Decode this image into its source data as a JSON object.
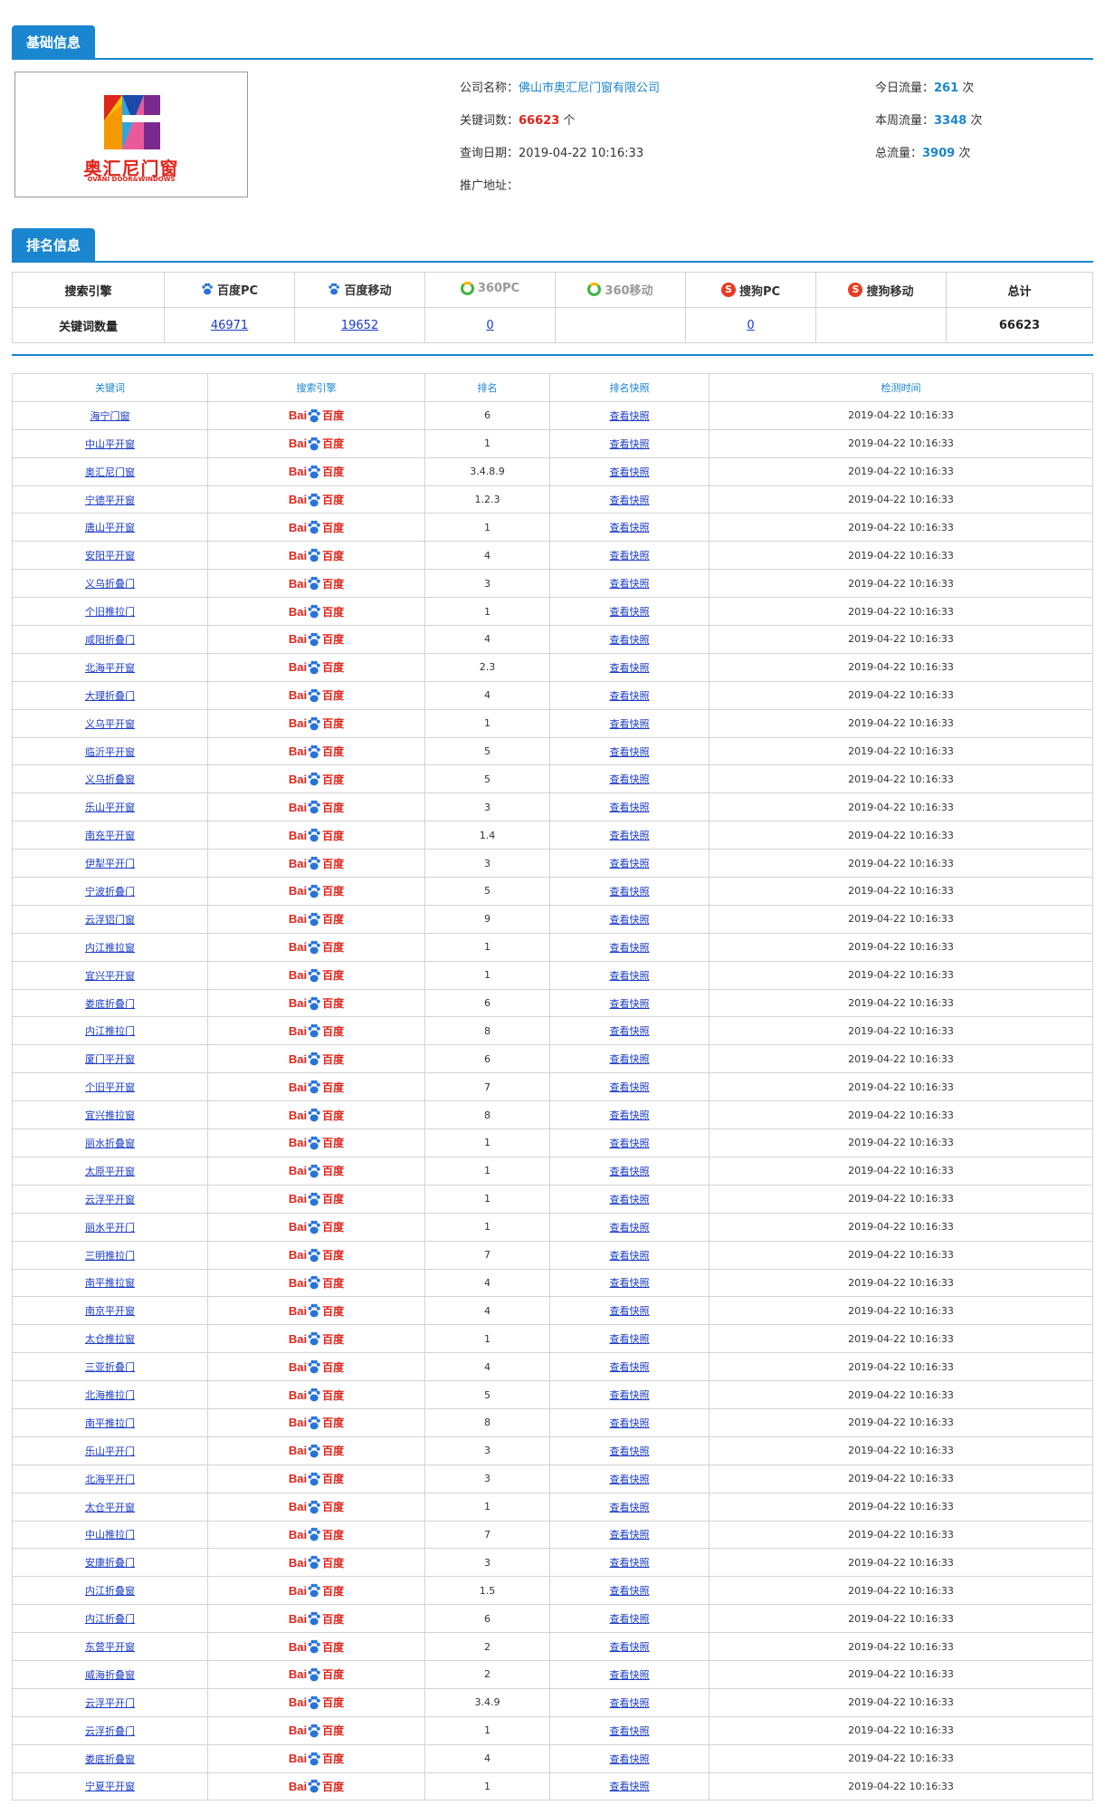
{
  "basic": {
    "tab": "基础信息",
    "logo_cn": "奥汇尼门窗",
    "logo_en": "OVANI DOOR&WINDOWS",
    "company_label": "公司名称：",
    "company_value": "佛山市奥汇尼门窗有限公司",
    "keywords_label": "关键词数：",
    "keywords_value": "66623",
    "keywords_unit": "个",
    "date_label": "查询日期：",
    "date_value": "2019-04-22 10:16:33",
    "promo_label": "推广地址：",
    "today_label": "今日流量：",
    "today_value": "261",
    "week_label": "本周流量：",
    "week_value": "3348",
    "total_label": "总流量：",
    "total_value": "3909",
    "times_unit": "次"
  },
  "ranking": {
    "tab": "排名信息",
    "header_first": "搜索引擎",
    "engines": [
      "百度PC",
      "百度移动",
      "360PC",
      "360移动",
      "搜狗PC",
      "搜狗移动"
    ],
    "header_total": "总计",
    "row_label": "关键词数量",
    "counts": [
      "46971",
      "19652",
      "0",
      "",
      "0",
      ""
    ],
    "total": "66623"
  },
  "keyword_table": {
    "headers": [
      "关键词",
      "搜索引擎",
      "排名",
      "排名快照",
      "检测时间"
    ],
    "engine_logo_text": [
      "Bai",
      "百度"
    ],
    "snapshot_label": "查看快照",
    "rows": [
      {
        "kw": "海宁门窗",
        "rank": "6",
        "time": "2019-04-22 10:16:33"
      },
      {
        "kw": "中山平开窗",
        "rank": "1",
        "time": "2019-04-22 10:16:33"
      },
      {
        "kw": "奥汇尼门窗",
        "rank": "3.4.8.9",
        "time": "2019-04-22 10:16:33"
      },
      {
        "kw": "宁德平开窗",
        "rank": "1.2.3",
        "time": "2019-04-22 10:16:33"
      },
      {
        "kw": "唐山平开窗",
        "rank": "1",
        "time": "2019-04-22 10:16:33"
      },
      {
        "kw": "安阳平开窗",
        "rank": "4",
        "time": "2019-04-22 10:16:33"
      },
      {
        "kw": "义乌折叠门",
        "rank": "3",
        "time": "2019-04-22 10:16:33"
      },
      {
        "kw": "个旧推拉门",
        "rank": "1",
        "time": "2019-04-22 10:16:33"
      },
      {
        "kw": "咸阳折叠门",
        "rank": "4",
        "time": "2019-04-22 10:16:33"
      },
      {
        "kw": "北海平开窗",
        "rank": "2.3",
        "time": "2019-04-22 10:16:33"
      },
      {
        "kw": "大理折叠门",
        "rank": "4",
        "time": "2019-04-22 10:16:33"
      },
      {
        "kw": "义乌平开窗",
        "rank": "1",
        "time": "2019-04-22 10:16:33"
      },
      {
        "kw": "临沂平开窗",
        "rank": "5",
        "time": "2019-04-22 10:16:33"
      },
      {
        "kw": "义乌折叠窗",
        "rank": "5",
        "time": "2019-04-22 10:16:33"
      },
      {
        "kw": "乐山平开窗",
        "rank": "3",
        "time": "2019-04-22 10:16:33"
      },
      {
        "kw": "南充平开窗",
        "rank": "1.4",
        "time": "2019-04-22 10:16:33"
      },
      {
        "kw": "伊犁平开门",
        "rank": "3",
        "time": "2019-04-22 10:16:33"
      },
      {
        "kw": "宁波折叠门",
        "rank": "5",
        "time": "2019-04-22 10:16:33"
      },
      {
        "kw": "云浮铝门窗",
        "rank": "9",
        "time": "2019-04-22 10:16:33"
      },
      {
        "kw": "内江推拉窗",
        "rank": "1",
        "time": "2019-04-22 10:16:33"
      },
      {
        "kw": "宜兴平开窗",
        "rank": "1",
        "time": "2019-04-22 10:16:33"
      },
      {
        "kw": "娄底折叠门",
        "rank": "6",
        "time": "2019-04-22 10:16:33"
      },
      {
        "kw": "内江推拉门",
        "rank": "8",
        "time": "2019-04-22 10:16:33"
      },
      {
        "kw": "厦门平开窗",
        "rank": "6",
        "time": "2019-04-22 10:16:33"
      },
      {
        "kw": "个旧平开窗",
        "rank": "7",
        "time": "2019-04-22 10:16:33"
      },
      {
        "kw": "宜兴推拉窗",
        "rank": "8",
        "time": "2019-04-22 10:16:33"
      },
      {
        "kw": "丽水折叠窗",
        "rank": "1",
        "time": "2019-04-22 10:16:33"
      },
      {
        "kw": "太原平开窗",
        "rank": "1",
        "time": "2019-04-22 10:16:33"
      },
      {
        "kw": "云浮平开窗",
        "rank": "1",
        "time": "2019-04-22 10:16:33"
      },
      {
        "kw": "丽水平开门",
        "rank": "1",
        "time": "2019-04-22 10:16:33"
      },
      {
        "kw": "三明推拉门",
        "rank": "7",
        "time": "2019-04-22 10:16:33"
      },
      {
        "kw": "南平推拉窗",
        "rank": "4",
        "time": "2019-04-22 10:16:33"
      },
      {
        "kw": "南京平开窗",
        "rank": "4",
        "time": "2019-04-22 10:16:33"
      },
      {
        "kw": "太仓推拉窗",
        "rank": "1",
        "time": "2019-04-22 10:16:33"
      },
      {
        "kw": "三亚折叠门",
        "rank": "4",
        "time": "2019-04-22 10:16:33"
      },
      {
        "kw": "北海推拉门",
        "rank": "5",
        "time": "2019-04-22 10:16:33"
      },
      {
        "kw": "南平推拉门",
        "rank": "8",
        "time": "2019-04-22 10:16:33"
      },
      {
        "kw": "乐山平开门",
        "rank": "3",
        "time": "2019-04-22 10:16:33"
      },
      {
        "kw": "北海平开门",
        "rank": "3",
        "time": "2019-04-22 10:16:33"
      },
      {
        "kw": "太仓平开窗",
        "rank": "1",
        "time": "2019-04-22 10:16:33"
      },
      {
        "kw": "中山推拉门",
        "rank": "7",
        "time": "2019-04-22 10:16:33"
      },
      {
        "kw": "安康折叠门",
        "rank": "3",
        "time": "2019-04-22 10:16:33"
      },
      {
        "kw": "内江折叠窗",
        "rank": "1.5",
        "time": "2019-04-22 10:16:33"
      },
      {
        "kw": "内江折叠门",
        "rank": "6",
        "time": "2019-04-22 10:16:33"
      },
      {
        "kw": "东营平开窗",
        "rank": "2",
        "time": "2019-04-22 10:16:33"
      },
      {
        "kw": "威海折叠窗",
        "rank": "2",
        "time": "2019-04-22 10:16:33"
      },
      {
        "kw": "云浮平开门",
        "rank": "3.4.9",
        "time": "2019-04-22 10:16:33"
      },
      {
        "kw": "云浮折叠门",
        "rank": "1",
        "time": "2019-04-22 10:16:33"
      },
      {
        "kw": "娄底折叠窗",
        "rank": "4",
        "time": "2019-04-22 10:16:33"
      },
      {
        "kw": "宁夏平开窗",
        "rank": "1",
        "time": "2019-04-22 10:16:33"
      }
    ]
  },
  "colors": {
    "accent": "#1a86cf",
    "red": "#e0251b",
    "link": "#1a3bc4"
  },
  "icons": {
    "baidu": "baidu-paw-icon",
    "360": "360-ring-icon",
    "sogou": "sogou-s-icon"
  }
}
